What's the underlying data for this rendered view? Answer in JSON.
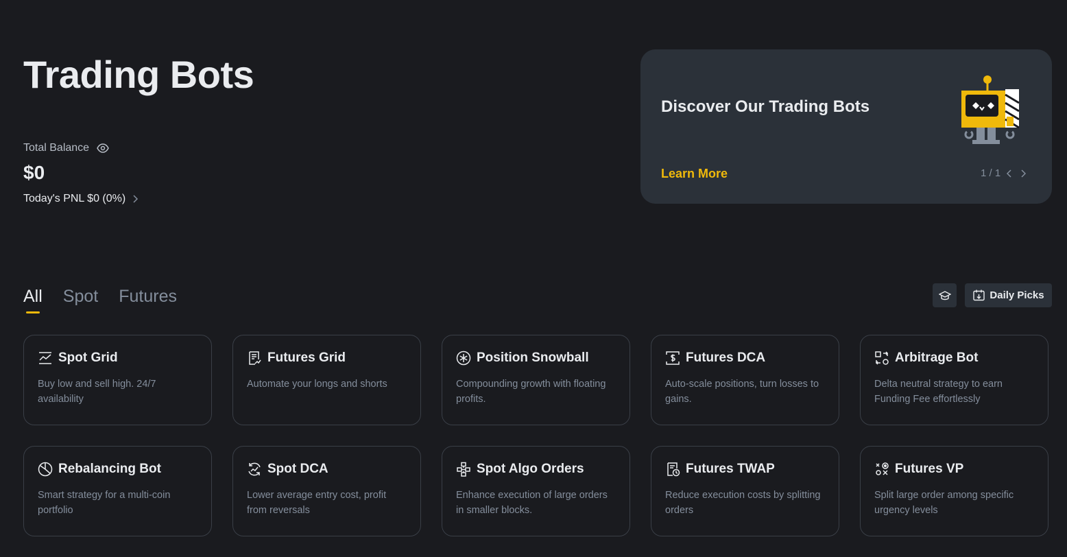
{
  "header": {
    "title": "Trading Bots"
  },
  "balance": {
    "label": "Total Balance",
    "value": "$0",
    "pnl": "Today's PNL $0 (0%)"
  },
  "banner": {
    "title": "Discover Our Trading Bots",
    "link": "Learn More",
    "pager": "1 / 1"
  },
  "tabs": [
    {
      "label": "All",
      "active": true
    },
    {
      "label": "Spot",
      "active": false
    },
    {
      "label": "Futures",
      "active": false
    }
  ],
  "toolbar": {
    "daily_picks": "Daily Picks"
  },
  "colors": {
    "accent": "#f0b90b",
    "background": "#1a1b1f",
    "card_border": "#3a3f47",
    "banner_bg": "#2b3139"
  },
  "bots": [
    {
      "title": "Spot Grid",
      "desc": "Buy low and sell high. 24/7 availability",
      "icon": "grid-chart-icon"
    },
    {
      "title": "Futures Grid",
      "desc": "Automate your longs and shorts",
      "icon": "document-chart-icon"
    },
    {
      "title": "Position Snowball",
      "desc": "Compounding growth with floating profits.",
      "icon": "snowflake-icon"
    },
    {
      "title": "Futures DCA",
      "desc": "Auto-scale positions, turn losses to gains.",
      "icon": "dollar-frame-icon"
    },
    {
      "title": "Arbitrage Bot",
      "desc": "Delta neutral strategy to earn Funding Fee effortlessly",
      "icon": "arbitrage-icon"
    },
    {
      "title": "Rebalancing Bot",
      "desc": "Smart strategy for a multi-coin portfolio",
      "icon": "pie-chart-icon"
    },
    {
      "title": "Spot DCA",
      "desc": "Lower average entry cost, profit from reversals",
      "icon": "refresh-chart-icon"
    },
    {
      "title": "Spot Algo Orders",
      "desc": "Enhance execution of large orders in smaller blocks.",
      "icon": "blocks-icon"
    },
    {
      "title": "Futures TWAP",
      "desc": "Reduce execution costs by splitting orders",
      "icon": "document-clock-icon"
    },
    {
      "title": "Futures VP",
      "desc": "Split large order among specific urgency levels",
      "icon": "target-grid-icon"
    }
  ]
}
